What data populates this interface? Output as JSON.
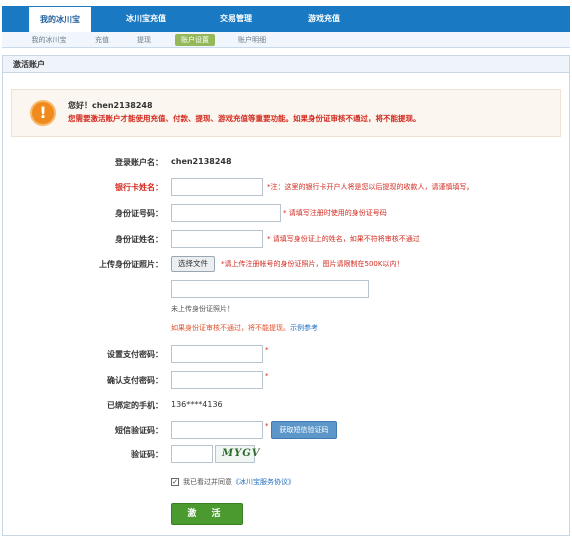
{
  "topnav": {
    "tabs": [
      {
        "label": "我的冰川宝",
        "active": true
      },
      {
        "label": "冰川宝充值",
        "active": false
      },
      {
        "label": "交易管理",
        "active": false
      },
      {
        "label": "游戏充值",
        "active": false
      }
    ]
  },
  "subnav": {
    "tabs": [
      {
        "label": "我的冰川宝",
        "active": false
      },
      {
        "label": "充值",
        "active": false
      },
      {
        "label": "提现",
        "active": false
      },
      {
        "label": "账户设置",
        "active": true
      },
      {
        "label": "账户明细",
        "active": false
      }
    ]
  },
  "panel": {
    "title": "激活账户",
    "alert": {
      "hello": "您好！chen2138248",
      "message": "您需要激活账户才能使用充值、付款、提现、游戏充值等重要功能。如果身份证审核不通过，将不能提现。"
    },
    "form": {
      "login_label": "登录账户名：",
      "login_value": "chen2138248",
      "bank_label": "银行卡姓名：",
      "bank_value": "",
      "bank_hint": "*注：这里的银行卡开户人将是您以后提现的收款人，请谨慎填写。",
      "idnum_label": "身份证号码：",
      "idnum_value": "",
      "idnum_hint": "* 请填写注册时使用的身份证号码",
      "idname_label": "身份证姓名：",
      "idname_value": "",
      "idname_hint": "* 请填写身份证上的姓名，如果不符将审核不通过",
      "upload_label": "上传身份证照片：",
      "upload_button": "选择文件",
      "upload_hint": "*请上传注册帐号的身份证照片，图片请限制在500K以内！",
      "upload_path": "",
      "upload_status": "未上传身份证照片！",
      "upload_warning": "如果身份证审核不通过，将不能提现。",
      "upload_example": "示例参考",
      "paypwd_label": "设置支付密码：",
      "paypwd_value": "",
      "paypwd_confirm_label": "确认支付密码：",
      "paypwd_confirm_value": "",
      "star": "*",
      "phone_label": "已绑定的手机：",
      "phone_value": "136****4136",
      "sms_label": "短信验证码：",
      "sms_value": "",
      "sms_button": "获取短信验证码",
      "captcha_label": "验证码：",
      "captcha_value": "",
      "captcha_text": "MYGV",
      "agree_check": "✓",
      "agree_text": "我已看过并同意",
      "agree_link": "《冰川宝服务协议》",
      "submit": "激 活"
    }
  },
  "colors": {
    "nav_blue": "#1979c2",
    "accent_green": "#95b95a",
    "warn_red": "#d22a1f",
    "alert_orange": "#f08a1c",
    "submit_green": "#4a9a2f"
  }
}
